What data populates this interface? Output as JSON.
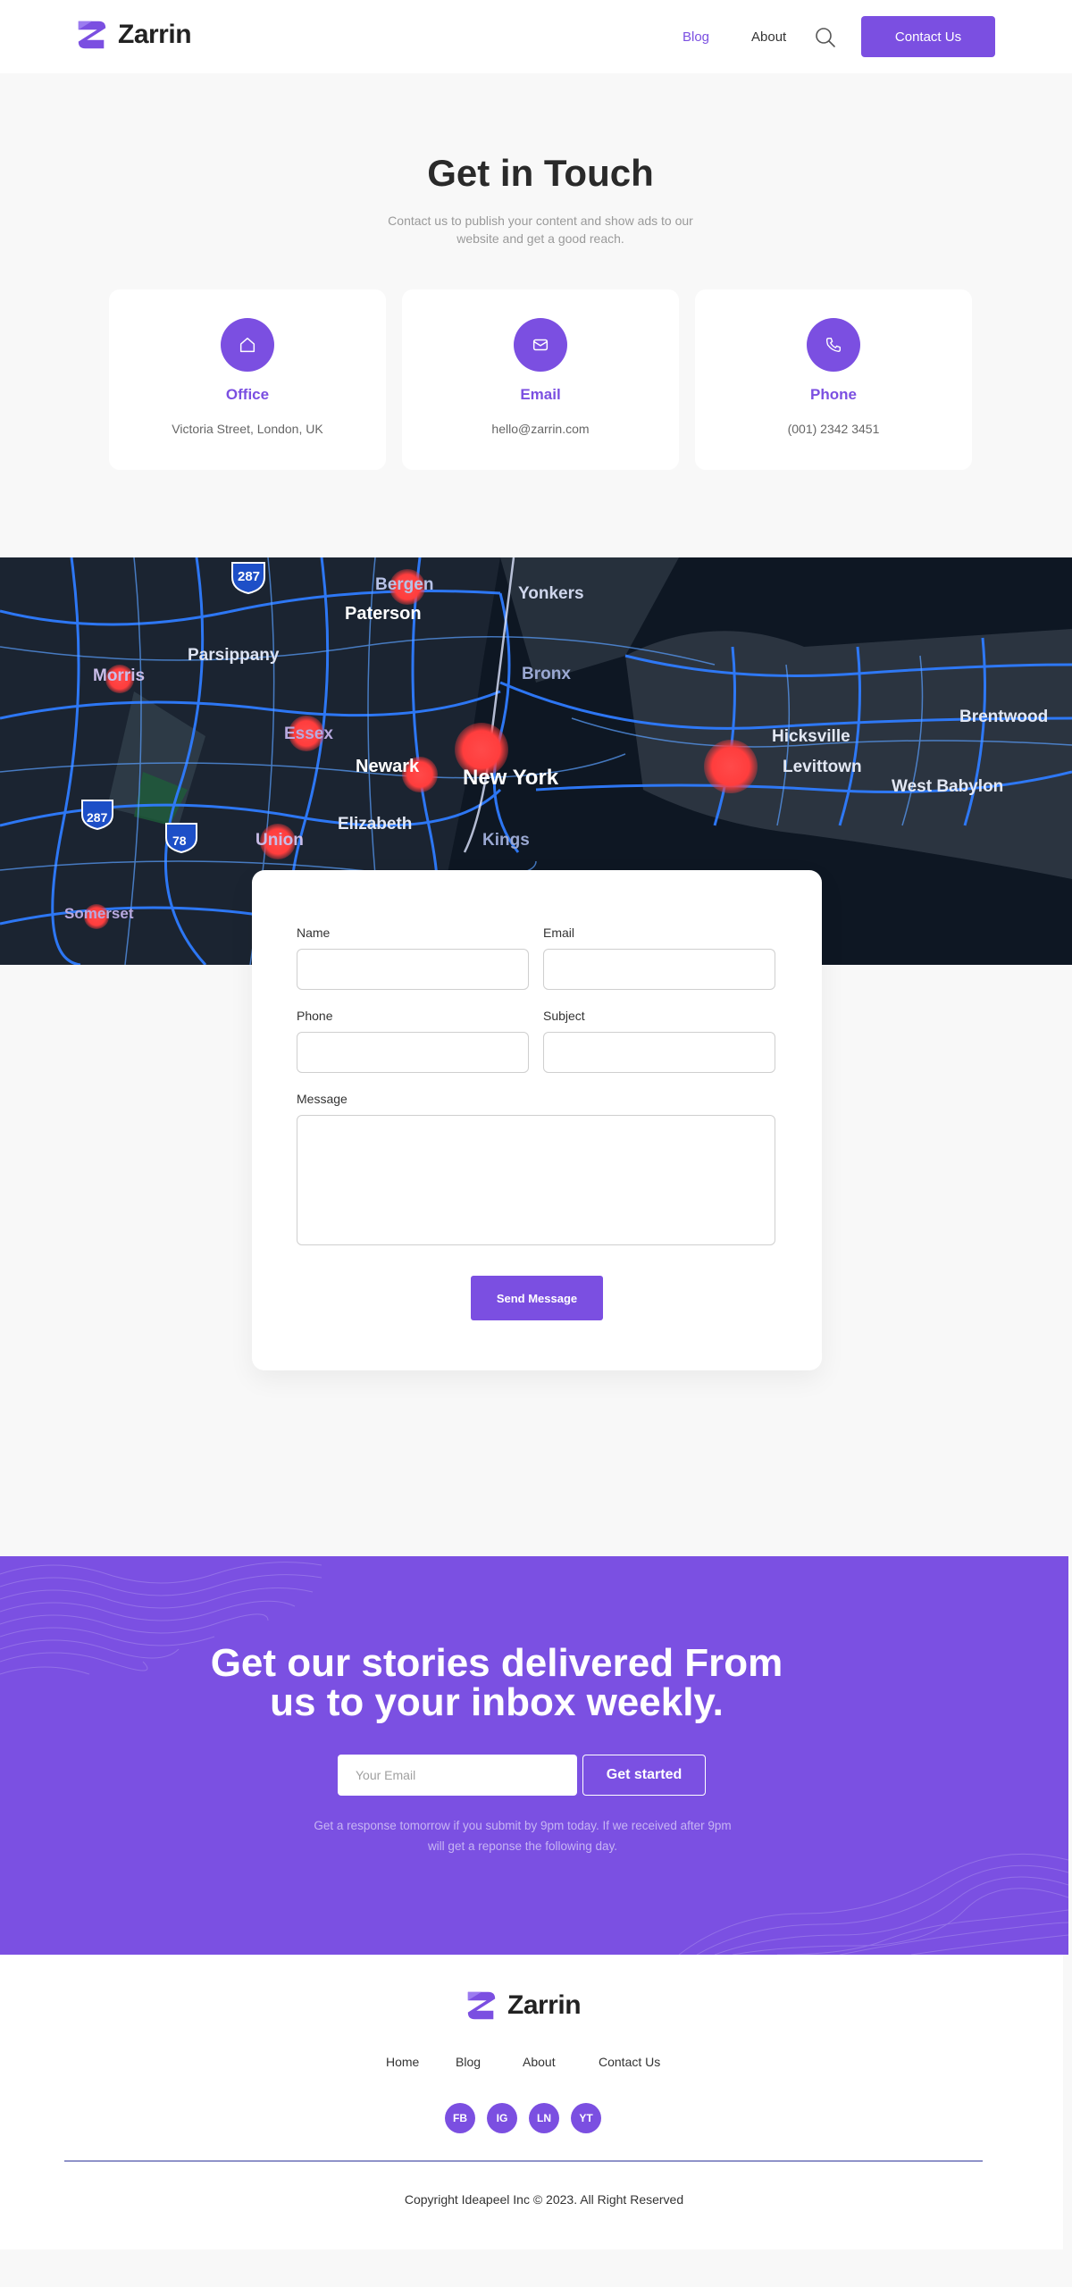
{
  "header": {
    "logo_text": "Zarrin",
    "nav": {
      "blog": "Blog",
      "about": "About"
    },
    "search_icon": "search-icon",
    "contact_button": "Contact Us"
  },
  "hero": {
    "title": "Get in Touch",
    "subtitle": "Contact us to publish your content and show ads to our website and get a good reach."
  },
  "cards": [
    {
      "icon": "home-icon",
      "title": "Office",
      "value": "Victoria Street, London, UK"
    },
    {
      "icon": "mail-icon",
      "title": "Email",
      "value": "hello@zarrin.com"
    },
    {
      "icon": "phone-icon",
      "title": "Phone",
      "value": "(001) 2342 3451"
    }
  ],
  "map": {
    "labels": [
      "287",
      "Bergen",
      "Yonkers",
      "Paterson",
      "Parsippany",
      "Morris",
      "Bronx",
      "Essex",
      "Newark",
      "New York",
      "Hicksville",
      "Levittown",
      "Brentwood",
      "West Babylon",
      "287",
      "78",
      "Union",
      "Elizabeth",
      "Kings",
      "Somerset"
    ]
  },
  "form": {
    "name_label": "Name",
    "email_label": "Email",
    "phone_label": "Phone",
    "subject_label": "Subject",
    "message_label": "Message",
    "send_button": "Send Message"
  },
  "newsletter": {
    "title_line1": "Get our stories delivered From",
    "title_line2": "us to your inbox weekly.",
    "email_placeholder": "Your Email",
    "button": "Get started",
    "note": "Get a response tomorrow if you submit by 9pm today. If we received after 9pm will get a reponse the following day."
  },
  "footer": {
    "logo_text": "Zarrin",
    "nav": [
      "Home",
      "Blog",
      "About",
      "Contact Us"
    ],
    "social": [
      "FB",
      "IG",
      "LN",
      "YT"
    ],
    "copyright": "Copyright Ideapeel Inc © 2023. All Right Reserved"
  },
  "colors": {
    "accent": "#7b4fe1",
    "newsletter_bg": "#7b50e2",
    "page_bg": "#f8f8f8"
  }
}
